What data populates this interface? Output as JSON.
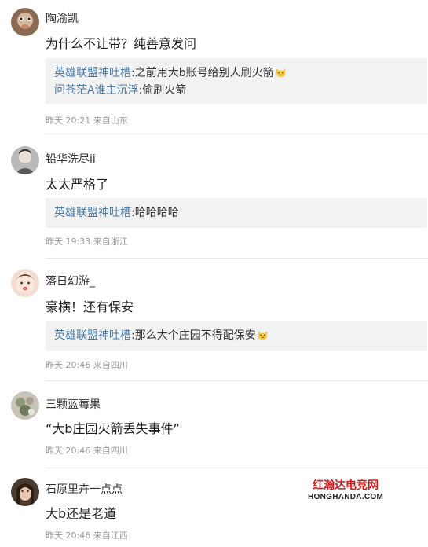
{
  "comments": [
    {
      "username": "陶渝凯",
      "text": "为什么不让带？纯善意发问",
      "replies": [
        {
          "author": "英雄联盟神吐槽",
          "sep": ":",
          "content": "之前用大b账号给别人刷火箭",
          "emoji": "smile-cat-emoji"
        },
        {
          "author": "问苍茫A谁主沉浮",
          "sep": ":",
          "content": "偷刷火箭",
          "emoji": ""
        }
      ],
      "meta": "昨天 20:21 来自山东"
    },
    {
      "username": "铅华洗尽ii",
      "text": "太太严格了",
      "replies": [
        {
          "author": "英雄联盟神吐槽",
          "sep": ":",
          "content": "哈哈哈哈",
          "emoji": ""
        }
      ],
      "meta": "昨天 19:33 来自浙江"
    },
    {
      "username": "落日幻游_",
      "text": "豪横！还有保安",
      "replies": [
        {
          "author": "英雄联盟神吐槽",
          "sep": ":",
          "content": "那么大个庄园不得配保安",
          "emoji": "smile-cat-emoji"
        }
      ],
      "meta": "昨天 20:46 来自四川"
    },
    {
      "username": "三颗蓝莓果",
      "text": "“大b庄园火箭丢失事件”",
      "replies": [],
      "meta": "昨天 20:46 来自四川"
    },
    {
      "username": "石原里卉一点点",
      "text": "大b还是老道",
      "replies": [],
      "meta": "昨天 20:46 来自江西"
    }
  ],
  "watermark": {
    "line1": "红瀚达电竞网",
    "line2": "HONGHANDA.COM"
  },
  "colors": {
    "reply_author": "#4a7aa8",
    "reply_bg": "#f2f2f2",
    "meta": "#999999",
    "watermark_red": "#c91f1f"
  }
}
